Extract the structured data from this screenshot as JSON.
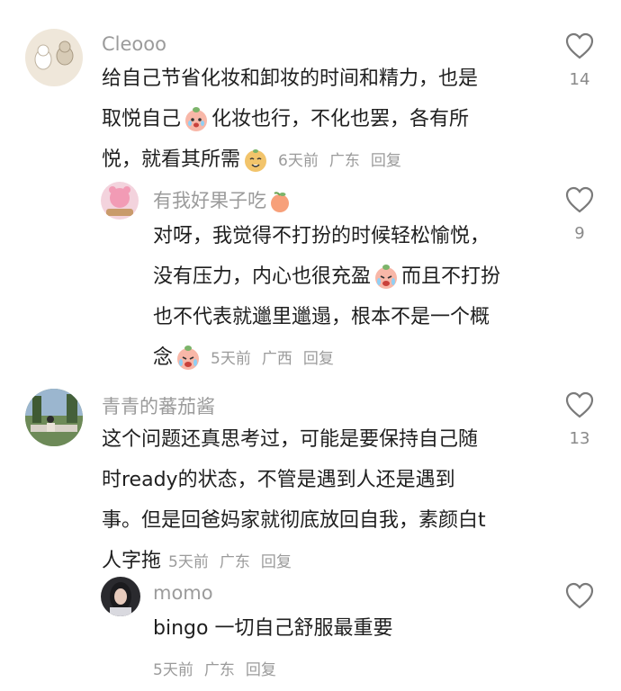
{
  "comments": [
    {
      "username": "Cleooo",
      "lines": [
        "给自己节省化妆和卸妆的时间和精力，也是",
        "取悦自己",
        "化妆也行，不化也罢，各有所",
        "悦，就看其所需"
      ],
      "time": "6天前",
      "location": "广东",
      "reply_label": "回复",
      "likes": "14",
      "avatar_icon": "cat-drawing-avatar",
      "emojis": [
        "peach-crying-emoji",
        "dog-smiling-emoji"
      ]
    },
    {
      "username": "有我好果子吃",
      "lines": [
        "对呀，我觉得不打扮的时候轻松愉悦，",
        "没有压力，内心也很充盈",
        "而且不打扮",
        "也不代表就邋里邋遢，根本不是一个概",
        "念"
      ],
      "time": "5天前",
      "location": "广西",
      "reply_label": "回复",
      "likes": "9",
      "avatar_icon": "pink-bear-avatar",
      "emojis": [
        "peach-emoji",
        "peach-crying-emoji",
        "peach-crying-emoji"
      ]
    },
    {
      "username": "青青的蕃茄酱",
      "lines": [
        "这个问题还真思考过，可能是要保持自己随",
        "时ready的状态，不管是遇到人还是遇到",
        "事。但是回爸妈家就彻底放回自我，素颜白t",
        "人字拖"
      ],
      "time": "5天前",
      "location": "广东",
      "reply_label": "回复",
      "likes": "13",
      "avatar_icon": "outdoor-photo-avatar"
    },
    {
      "username": "momo",
      "lines": [
        "bingo 一切自己舒服最重要"
      ],
      "time": "5天前",
      "location": "广东",
      "reply_label": "回复",
      "likes": "",
      "avatar_icon": "portrait-avatar"
    }
  ],
  "colors": {
    "text": "#1f1f1f",
    "meta": "#9b9b9b",
    "heart": "#7a7a7a",
    "peach": "#f4a08a"
  }
}
